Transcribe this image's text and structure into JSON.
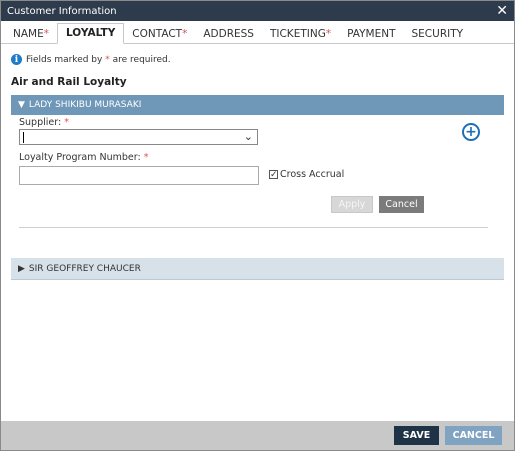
{
  "window": {
    "title": "Customer Information",
    "close_glyph": "✕"
  },
  "tabs": [
    {
      "label": "NAME",
      "required": "*"
    },
    {
      "label": "LOYALTY",
      "required": ""
    },
    {
      "label": "CONTACT",
      "required": "*"
    },
    {
      "label": "ADDRESS",
      "required": ""
    },
    {
      "label": "TICKETING",
      "required": "*"
    },
    {
      "label": "PAYMENT",
      "required": ""
    },
    {
      "label": "SECURITY",
      "required": ""
    }
  ],
  "notice": {
    "icon": "i",
    "before": "Fields marked by ",
    "star": "*",
    "after": " are required."
  },
  "section": {
    "title": "Air and Rail Loyalty"
  },
  "panels": [
    {
      "caret": "▼",
      "header": "LADY SHIKIBU MURASAKI",
      "supplier_label": "Supplier:",
      "supplier_required": "*",
      "supplier_value": "",
      "loyalty_label": "Loyalty Program Number:",
      "loyalty_required": "*",
      "loyalty_value": "",
      "cross_accrual_label": "Cross Accrual",
      "cross_accrual_checked": "✓",
      "apply_label": "Apply",
      "cancel_label": "Cancel"
    },
    {
      "caret": "▶",
      "header": "SIR GEOFFREY CHAUCER"
    }
  ],
  "footer": {
    "save_label": "SAVE",
    "cancel_label": "CANCEL"
  }
}
